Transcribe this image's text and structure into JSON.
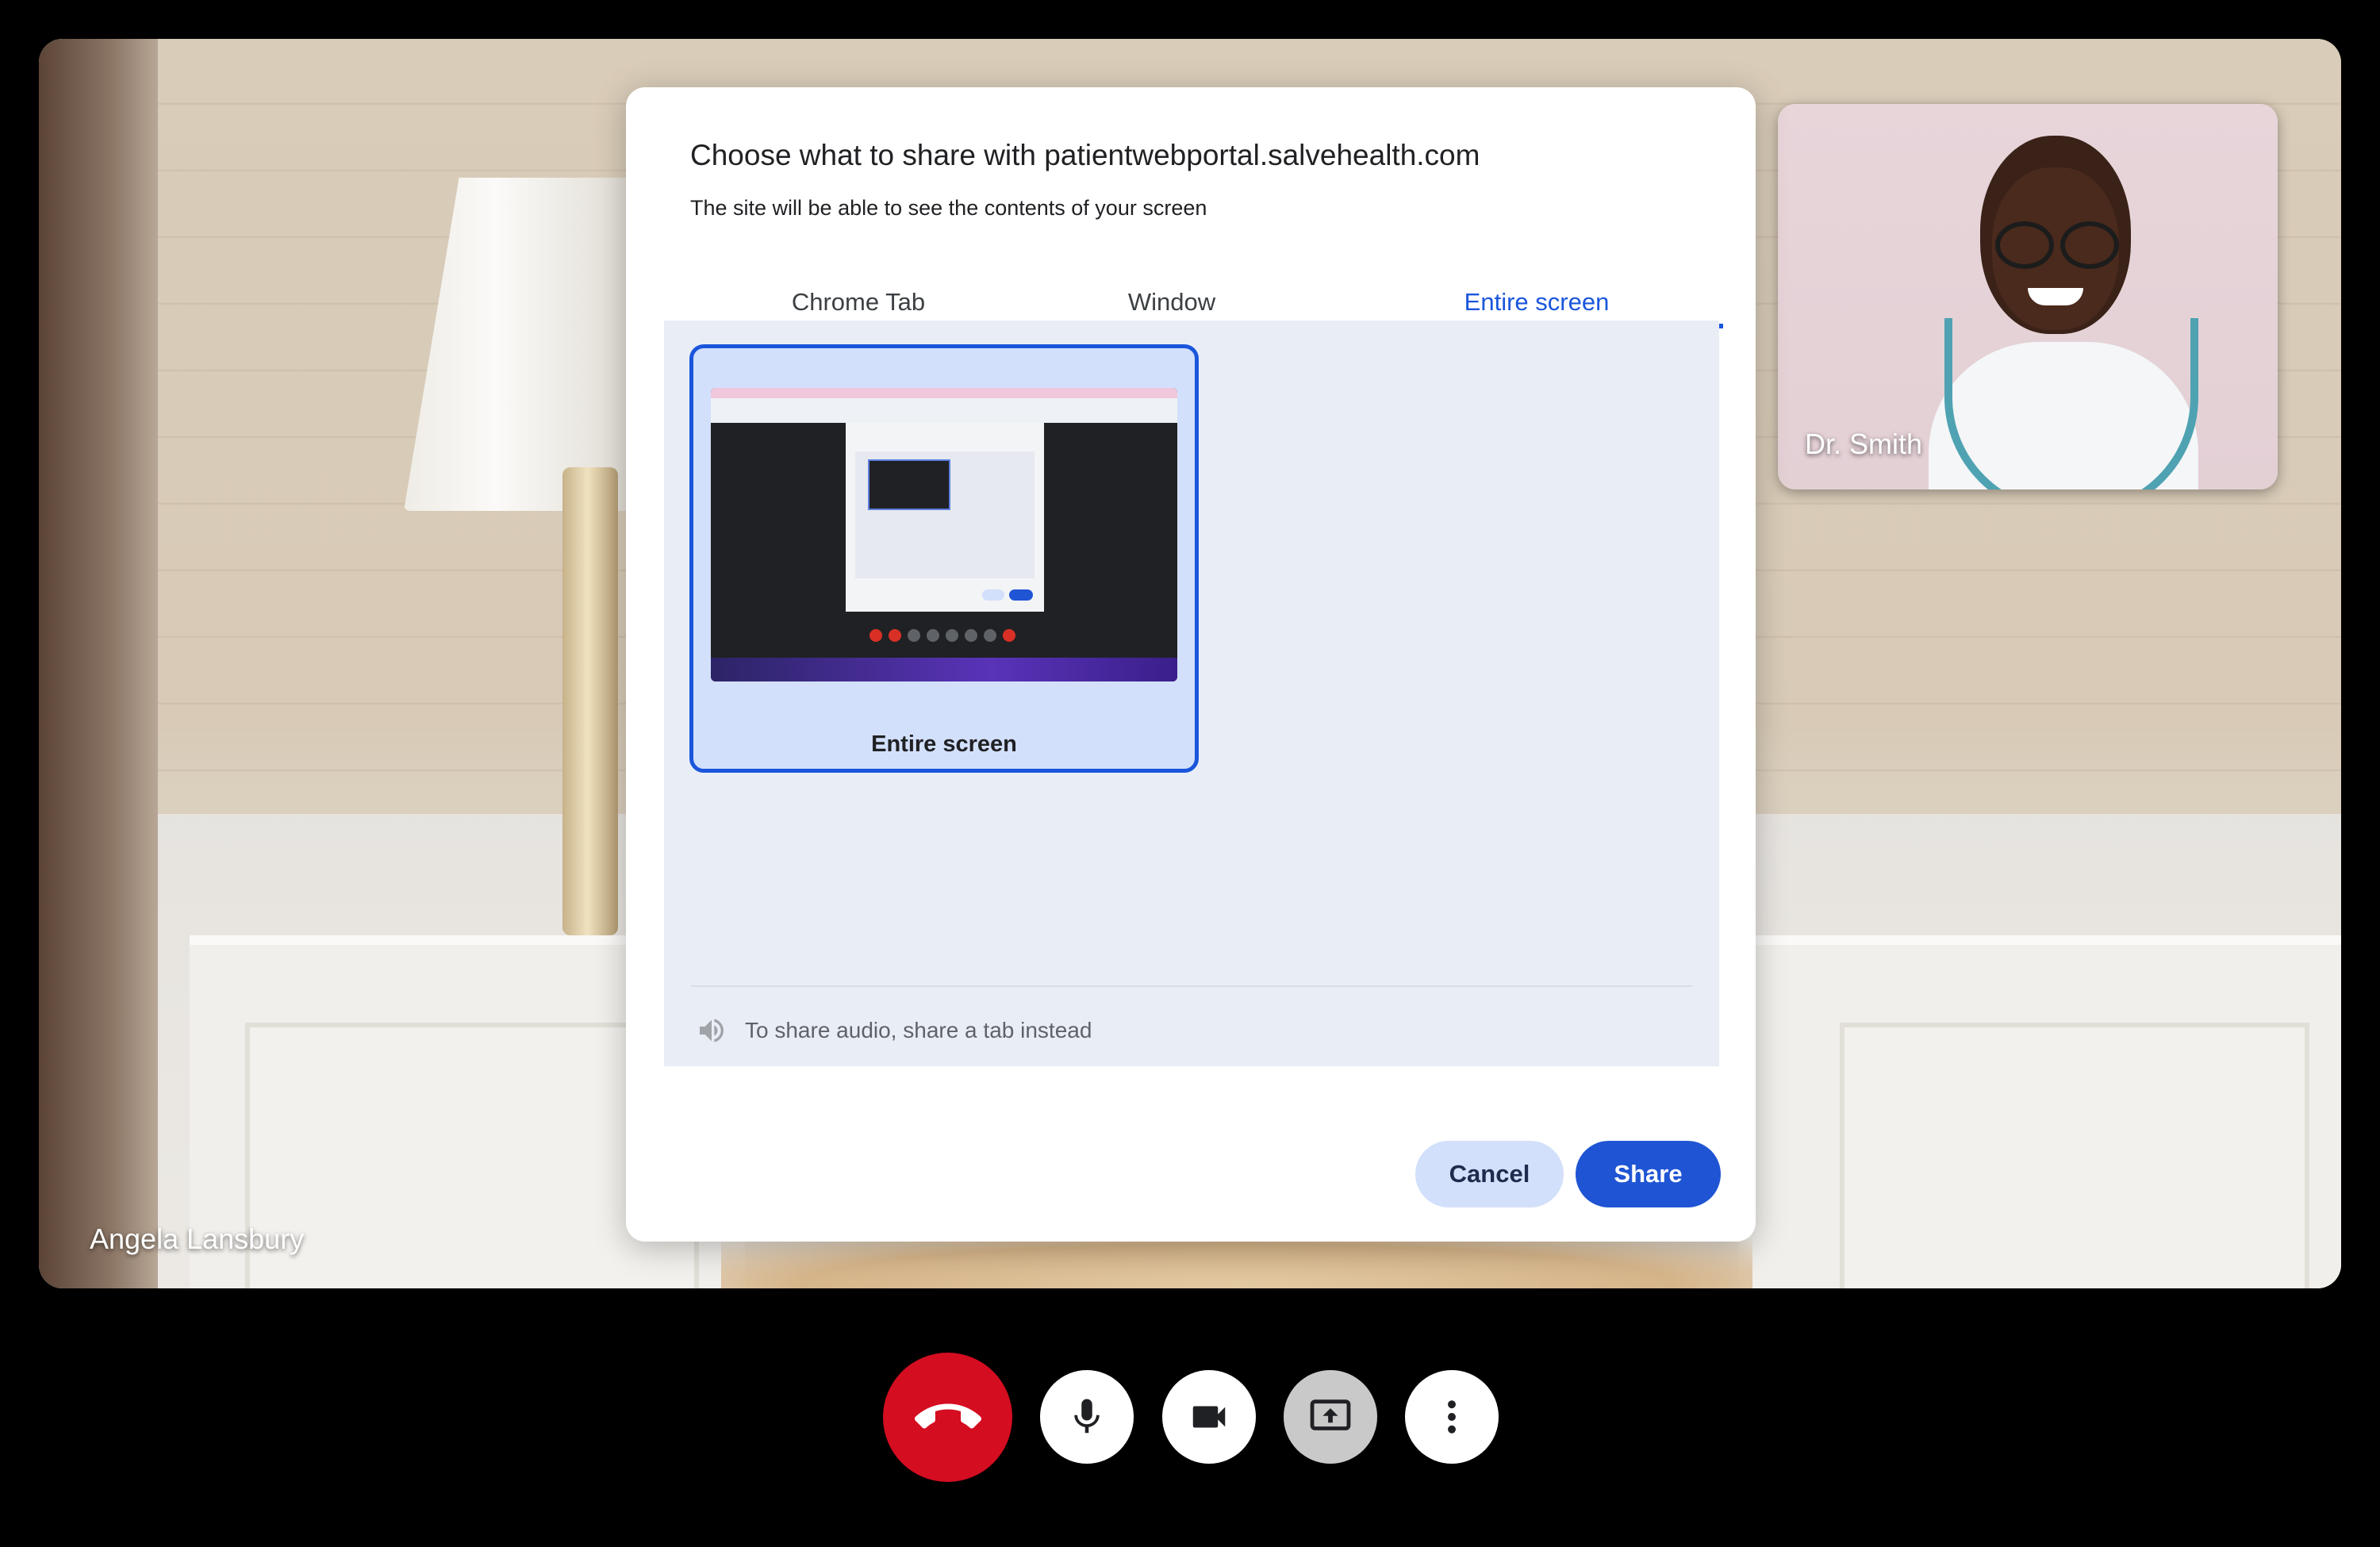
{
  "call": {
    "main_participant_name": "Angela Lansbury",
    "self_view_name": "Dr. Smith"
  },
  "dialog": {
    "title": "Choose what to share with patientwebportal.salvehealth.com",
    "subtitle": "The site will be able to see the contents of your screen",
    "tabs": [
      {
        "label": "Chrome Tab",
        "active": false
      },
      {
        "label": "Window",
        "active": false
      },
      {
        "label": "Entire screen",
        "active": true
      }
    ],
    "source_option_label": "Entire screen",
    "audio_note": "To share audio, share a tab instead",
    "cancel_label": "Cancel",
    "share_label": "Share"
  },
  "controls": [
    {
      "name": "end-call",
      "icon": "phone-hangup-icon",
      "color": "#d50d21"
    },
    {
      "name": "microphone",
      "icon": "microphone-icon",
      "color": "#ffffff"
    },
    {
      "name": "camera",
      "icon": "video-camera-icon",
      "color": "#ffffff"
    },
    {
      "name": "share-screen",
      "icon": "present-screen-icon",
      "color": "#c9c9c9"
    },
    {
      "name": "more-options",
      "icon": "more-vertical-icon",
      "color": "#ffffff"
    }
  ],
  "colors": {
    "accent": "#1a56db",
    "hangup": "#d50d21",
    "panel_bg": "#e9edf6"
  }
}
